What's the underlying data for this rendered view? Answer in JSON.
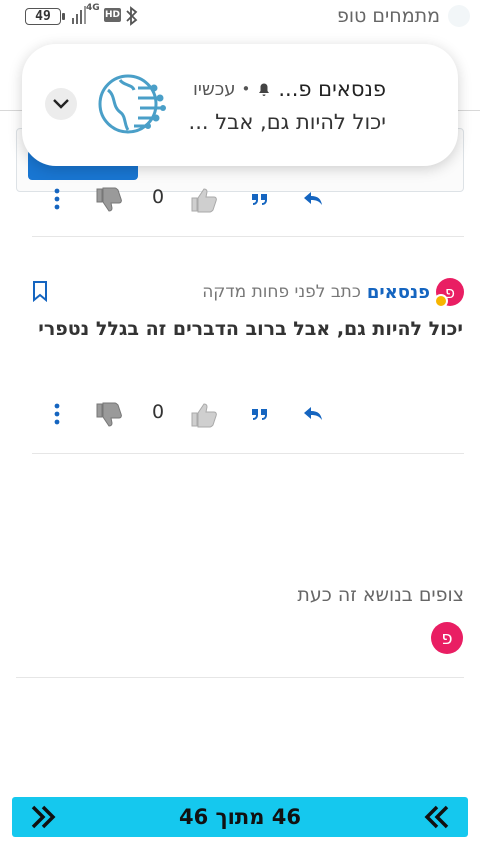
{
  "status_bar": {
    "battery": "49",
    "network": "4G",
    "hd": "HD"
  },
  "app": {
    "title": "מתמחים טופ"
  },
  "notification": {
    "app_name": "פנסאים פ...",
    "separator": "•",
    "time": "עכשיו",
    "body": "יכול להיות גם, אבל ..."
  },
  "post_top": {
    "upvote_count": "0"
  },
  "post": {
    "avatar_letter": "פ",
    "author": "פנסאים",
    "posted": "כתב לפני פחות מדקה",
    "text": "יכול להיות גם, אבל ברוב הדברים זה בגלל נטפרי",
    "upvote_count": "0"
  },
  "viewers": {
    "label": "צופים בנושא זה כעת",
    "avatar_letter": "פ"
  },
  "pagination": {
    "text": "46 מתוך 46"
  },
  "colors": {
    "accent_blue": "#1565c0",
    "pager_bg": "#15c8ee",
    "avatar_pink": "#e91e63",
    "status_online": "#f7b500"
  }
}
